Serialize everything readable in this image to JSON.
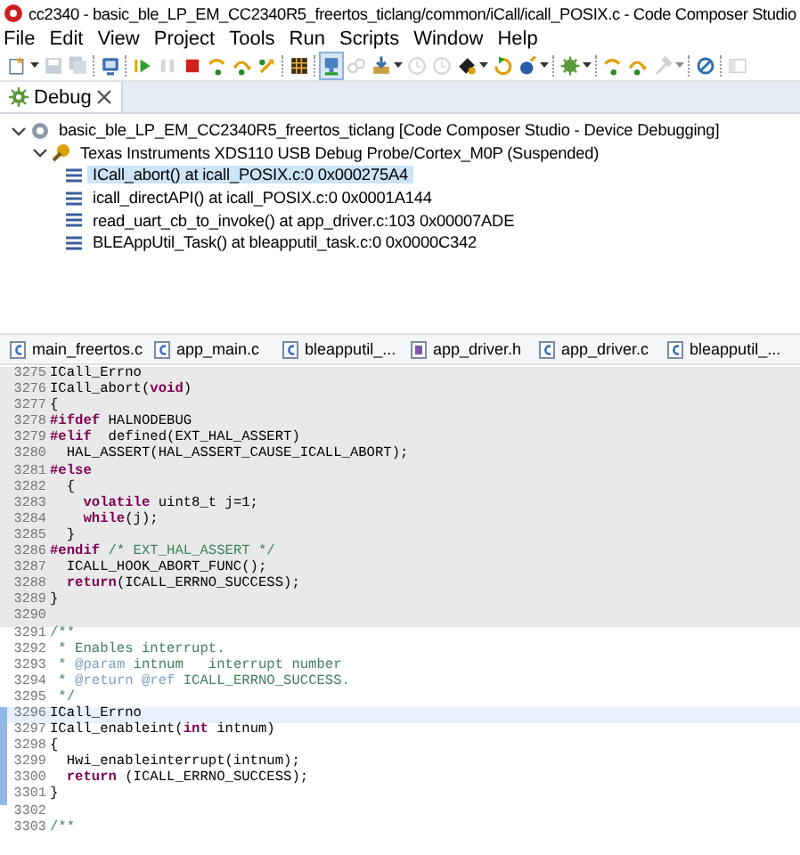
{
  "window": {
    "title": "cc2340 - basic_ble_LP_EM_CC2340R5_freertos_ticlang/common/iCall/icall_POSIX.c - Code Composer Studio"
  },
  "menu": [
    {
      "label": "File"
    },
    {
      "label": "Edit"
    },
    {
      "label": "View"
    },
    {
      "label": "Project"
    },
    {
      "label": "Tools"
    },
    {
      "label": "Run"
    },
    {
      "label": "Scripts"
    },
    {
      "label": "Window"
    },
    {
      "label": "Help"
    }
  ],
  "toolbar": [
    {
      "kind": "new",
      "disabled": false,
      "dropdown": true
    },
    {
      "kind": "save",
      "disabled": true
    },
    {
      "kind": "save-all",
      "disabled": true
    },
    {
      "kind": "sep"
    },
    {
      "kind": "monitor",
      "disabled": false
    },
    {
      "kind": "sep"
    },
    {
      "kind": "resume",
      "disabled": false
    },
    {
      "kind": "pause",
      "disabled": true
    },
    {
      "kind": "stop",
      "disabled": false
    },
    {
      "kind": "step-into",
      "disabled": false
    },
    {
      "kind": "step-over",
      "disabled": false
    },
    {
      "kind": "step-return",
      "disabled": false
    },
    {
      "kind": "sep"
    },
    {
      "kind": "grid",
      "disabled": false
    },
    {
      "kind": "sep"
    },
    {
      "kind": "connect",
      "disabled": false,
      "pressed": true
    },
    {
      "kind": "link",
      "disabled": true
    },
    {
      "kind": "load",
      "disabled": false,
      "dropdown": true
    },
    {
      "kind": "clock",
      "disabled": true
    },
    {
      "kind": "clock",
      "disabled": true
    },
    {
      "kind": "paint",
      "disabled": false,
      "dropdown": true
    },
    {
      "kind": "restart",
      "disabled": false
    },
    {
      "kind": "ball",
      "disabled": false,
      "dropdown": true
    },
    {
      "kind": "sep"
    },
    {
      "kind": "gear",
      "disabled": false,
      "dropdown": true
    },
    {
      "kind": "sep"
    },
    {
      "kind": "step-into",
      "disabled": false
    },
    {
      "kind": "step-over",
      "disabled": false
    },
    {
      "kind": "hammer",
      "disabled": true,
      "dropdown": true
    },
    {
      "kind": "sep"
    },
    {
      "kind": "no-entry",
      "disabled": false
    },
    {
      "kind": "sep"
    },
    {
      "kind": "panel",
      "disabled": true
    }
  ],
  "debug_view": {
    "tab": {
      "label": "Debug",
      "selected": true
    },
    "tree": [
      {
        "label": "basic_ble_LP_EM_CC2340R5_freertos_ticlang [Code Composer Studio - Device Debugging]",
        "kind": "session",
        "expanded": true,
        "selected": false,
        "children": [
          {
            "label": "Texas Instruments XDS110 USB Debug Probe/Cortex_M0P (Suspended)",
            "kind": "probe",
            "expanded": true,
            "selected": false,
            "children": [
              {
                "label": "ICall_abort() at icall_POSIX.c:0 0x000275A4",
                "kind": "frame",
                "selected": true
              },
              {
                "label": "icall_directAPI() at icall_POSIX.c:0 0x0001A144",
                "kind": "frame",
                "selected": false
              },
              {
                "label": "read_uart_cb_to_invoke() at app_driver.c:103 0x00007ADE",
                "kind": "frame",
                "selected": false
              },
              {
                "label": "BLEAppUtil_Task() at bleapputil_task.c:0 0x0000C342",
                "kind": "frame",
                "selected": false
              }
            ]
          }
        ]
      }
    ]
  },
  "editor": {
    "tabs": [
      {
        "label": "main_freertos.c",
        "kind": "c"
      },
      {
        "label": "app_main.c",
        "kind": "c"
      },
      {
        "label": "bleapputil_...",
        "kind": "c"
      },
      {
        "label": "app_driver.h",
        "kind": "h"
      },
      {
        "label": "app_driver.c",
        "kind": "c"
      },
      {
        "label": "bleapputil_...",
        "kind": "c"
      }
    ],
    "lines": [
      {
        "number": "3275",
        "shaded": true,
        "current": false,
        "changed": false,
        "parts": [
          {
            "kind": "plain",
            "text": "ICall_Errno"
          }
        ]
      },
      {
        "number": "3276",
        "shaded": true,
        "current": false,
        "changed": false,
        "parts": [
          {
            "kind": "plain",
            "text": "ICall_abort("
          },
          {
            "kind": "keyword",
            "text": "void"
          },
          {
            "kind": "plain",
            "text": ")"
          }
        ]
      },
      {
        "number": "3277",
        "shaded": true,
        "current": false,
        "changed": false,
        "parts": [
          {
            "kind": "plain",
            "text": "{"
          }
        ]
      },
      {
        "number": "3278",
        "shaded": true,
        "current": false,
        "changed": false,
        "parts": [
          {
            "kind": "keyword",
            "text": "#ifdef"
          },
          {
            "kind": "plain",
            "text": " HALNODEBUG"
          }
        ]
      },
      {
        "number": "3279",
        "shaded": true,
        "current": false,
        "changed": false,
        "parts": [
          {
            "kind": "keyword",
            "text": "#elif"
          },
          {
            "kind": "plain",
            "text": "  defined(EXT_HAL_ASSERT)"
          }
        ]
      },
      {
        "number": "3280",
        "shaded": true,
        "current": false,
        "changed": false,
        "parts": [
          {
            "kind": "plain",
            "text": "  HAL_ASSERT(HAL_ASSERT_CAUSE_ICALL_ABORT);"
          }
        ]
      },
      {
        "number": "3281",
        "shaded": true,
        "current": false,
        "changed": false,
        "parts": [
          {
            "kind": "keyword",
            "text": "#else"
          }
        ]
      },
      {
        "number": "3282",
        "shaded": true,
        "current": false,
        "changed": false,
        "parts": [
          {
            "kind": "plain",
            "text": "  {"
          }
        ]
      },
      {
        "number": "3283",
        "shaded": true,
        "current": false,
        "changed": false,
        "parts": [
          {
            "kind": "keyword",
            "text": "    volatile"
          },
          {
            "kind": "plain",
            "text": " uint8_t j=1;"
          }
        ]
      },
      {
        "number": "3284",
        "shaded": true,
        "current": false,
        "changed": false,
        "parts": [
          {
            "kind": "keyword",
            "text": "    while"
          },
          {
            "kind": "plain",
            "text": "(j);"
          }
        ]
      },
      {
        "number": "3285",
        "shaded": true,
        "current": false,
        "changed": false,
        "parts": [
          {
            "kind": "plain",
            "text": "  }"
          }
        ]
      },
      {
        "number": "3286",
        "shaded": true,
        "current": false,
        "changed": false,
        "parts": [
          {
            "kind": "keyword",
            "text": "#endif"
          },
          {
            "kind": "comment",
            "text": " /* EXT_HAL_ASSERT */"
          }
        ]
      },
      {
        "number": "3287",
        "shaded": true,
        "current": false,
        "changed": false,
        "parts": [
          {
            "kind": "plain",
            "text": "  ICALL_HOOK_ABORT_FUNC();"
          }
        ]
      },
      {
        "number": "3288",
        "shaded": true,
        "current": false,
        "changed": false,
        "parts": [
          {
            "kind": "keyword",
            "text": "  return"
          },
          {
            "kind": "plain",
            "text": "(ICALL_ERRNO_SUCCESS);"
          }
        ]
      },
      {
        "number": "3289",
        "shaded": true,
        "current": false,
        "changed": false,
        "parts": [
          {
            "kind": "plain",
            "text": "}"
          }
        ]
      },
      {
        "number": "3290",
        "shaded": true,
        "current": false,
        "changed": false
      },
      {
        "number": "3291",
        "shaded": false,
        "current": false,
        "changed": false,
        "parts": [
          {
            "kind": "comment",
            "text": "/**"
          }
        ]
      },
      {
        "number": "3292",
        "shaded": false,
        "current": false,
        "changed": false,
        "parts": [
          {
            "kind": "comment",
            "text": " * Enables interrupt."
          }
        ]
      },
      {
        "number": "3293",
        "shaded": false,
        "current": false,
        "changed": false,
        "parts": [
          {
            "kind": "comment",
            "text": " * "
          },
          {
            "kind": "doctag",
            "text": "@param"
          },
          {
            "kind": "comment",
            "text": " intnum   interrupt number"
          }
        ]
      },
      {
        "number": "3294",
        "shaded": false,
        "current": false,
        "changed": false,
        "parts": [
          {
            "kind": "comment",
            "text": " * "
          },
          {
            "kind": "doctag",
            "text": "@return @ref"
          },
          {
            "kind": "comment",
            "text": " ICALL_ERRNO_SUCCESS."
          }
        ]
      },
      {
        "number": "3295",
        "shaded": false,
        "current": false,
        "changed": false,
        "parts": [
          {
            "kind": "comment",
            "text": " */"
          }
        ]
      },
      {
        "number": "3296",
        "shaded": false,
        "current": true,
        "changed": true,
        "parts": [
          {
            "kind": "plain",
            "text": "ICall_Errno"
          }
        ]
      },
      {
        "number": "3297",
        "shaded": false,
        "current": false,
        "changed": true,
        "parts": [
          {
            "kind": "plain",
            "text": "ICall_enableint("
          },
          {
            "kind": "keyword",
            "text": "int"
          },
          {
            "kind": "plain",
            "text": " intnum)"
          }
        ]
      },
      {
        "number": "3298",
        "shaded": false,
        "current": false,
        "changed": true,
        "parts": [
          {
            "kind": "plain",
            "text": "{"
          }
        ]
      },
      {
        "number": "3299",
        "shaded": false,
        "current": false,
        "changed": true,
        "parts": [
          {
            "kind": "plain",
            "text": "  Hwi_enableinterrupt(intnum);"
          }
        ]
      },
      {
        "number": "3300",
        "shaded": false,
        "current": false,
        "changed": true,
        "parts": [
          {
            "kind": "keyword",
            "text": "  return"
          },
          {
            "kind": "plain",
            "text": " (ICALL_ERRNO_SUCCESS);"
          }
        ]
      },
      {
        "number": "3301",
        "shaded": false,
        "current": false,
        "changed": true,
        "parts": [
          {
            "kind": "plain",
            "text": "}"
          }
        ]
      },
      {
        "number": "3302",
        "shaded": false,
        "current": false,
        "changed": false
      },
      {
        "number": "3303",
        "shaded": false,
        "current": false,
        "changed": false,
        "parts": [
          {
            "kind": "comment",
            "text": "/**"
          }
        ]
      }
    ]
  }
}
